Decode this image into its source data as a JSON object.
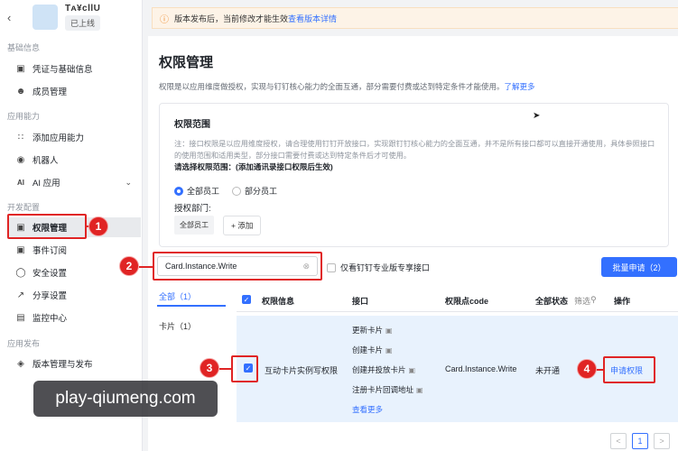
{
  "app": {
    "name": "Tᴀ¥ᴄllU",
    "status": "已上线"
  },
  "sidebar": {
    "sections": [
      {
        "title": "基础信息",
        "items": [
          {
            "label": "凭证与基础信息",
            "icon": "credential-icon"
          },
          {
            "label": "成员管理",
            "icon": "user-icon"
          }
        ]
      },
      {
        "title": "应用能力",
        "items": [
          {
            "label": "添加应用能力",
            "icon": "grid-icon"
          },
          {
            "label": "机器人",
            "icon": "robot-icon"
          },
          {
            "label": "AI 应用",
            "icon": "ai-icon"
          }
        ]
      },
      {
        "title": "开发配置",
        "items": [
          {
            "label": "权限管理",
            "icon": "permission-icon"
          },
          {
            "label": "事件订阅",
            "icon": "event-icon"
          },
          {
            "label": "安全设置",
            "icon": "shield-icon"
          },
          {
            "label": "分享设置",
            "icon": "share-icon"
          },
          {
            "label": "监控中心",
            "icon": "monitor-icon"
          }
        ]
      },
      {
        "title": "应用发布",
        "items": [
          {
            "label": "版本管理与发布",
            "icon": "version-icon"
          }
        ]
      }
    ]
  },
  "notice": {
    "text": "版本发布后，当前修改才能生效",
    "link": "查看版本详情"
  },
  "page": {
    "title": "权限管理",
    "desc": "权限是以应用维度做授权，实现与钉钉核心能力的全面互通，部分需要付费或达到特定条件才能使用。",
    "desc_link": "了解更多"
  },
  "scope": {
    "title": "权限范围",
    "note": "注：接口权限是以应用维度授权，请合理使用钉钉开放接口，实现跟钉钉核心能力的全面互通，并不是所有接口都可以直接开通使用，具体参照接口的使用范围和适用类型，部分接口需要付费或达到特定条件后才可使用。",
    "select_label": "请选择权限范围：(添加通讯录接口权限后生效)",
    "option_all": "全部员工",
    "option_part": "部分员工",
    "auth_label": "授权部门:",
    "dept": "全部员工",
    "add": "+ 添加"
  },
  "search": {
    "value": "Card.Instance.Write"
  },
  "filter": {
    "label": "仅看钉钉专业版专享接口"
  },
  "batch": {
    "label": "批量申请（2）"
  },
  "categories": {
    "all": "全部（1）",
    "card": "卡片（1）"
  },
  "table": {
    "headers": {
      "info": "权限信息",
      "interface": "接口",
      "code": "权限点code",
      "status": "全部状态",
      "filter": "筛选",
      "action": "操作"
    },
    "row": {
      "name": "互动卡片实例写权限",
      "interfaces": [
        "更新卡片",
        "创建卡片",
        "创建并投放卡片",
        "注册卡片回调地址"
      ],
      "more": "查看更多",
      "code": "Card.Instance.Write",
      "status": "未开通",
      "action": "申请权限"
    }
  },
  "pagination": {
    "prev": "<",
    "current": "1",
    "next": ">"
  },
  "annotations": [
    "1",
    "2",
    "3",
    "4"
  ],
  "watermark": "play-qiumeng.com"
}
